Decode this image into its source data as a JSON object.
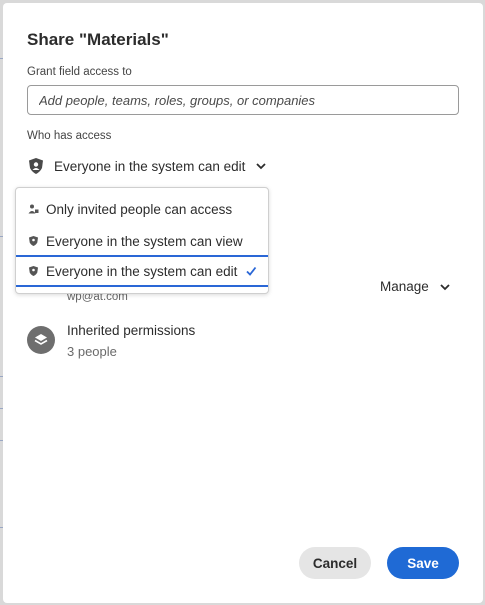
{
  "dialog": {
    "title": "Share \"Materials\"",
    "grant_label": "Grant field access to",
    "grant_placeholder": "Add people, teams, roles, groups, or companies",
    "who_label": "Who has access",
    "access_selected": "Everyone in the system can edit",
    "access_options": [
      {
        "label": "Only invited people can access",
        "icon": "invited-person-icon",
        "selected": false
      },
      {
        "label": "Everyone in the system can view",
        "icon": "shield-icon",
        "selected": false
      },
      {
        "label": "Everyone in the system can edit",
        "icon": "shield-icon",
        "selected": true
      }
    ],
    "member": {
      "email": "wp@at.com",
      "role_label": "Manage"
    },
    "inherited": {
      "title": "Inherited permissions",
      "count": "3 people"
    },
    "buttons": {
      "cancel": "Cancel",
      "save": "Save"
    }
  },
  "colors": {
    "primary": "#1f6ad5",
    "selected_border": "#2a67d6",
    "cancel_bg": "#e5e5e5"
  }
}
